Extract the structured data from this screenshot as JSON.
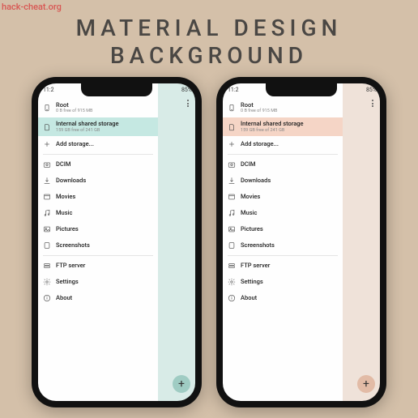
{
  "watermark": "hack-cheat.org",
  "heading_line1": "MATERIAL DESIGN",
  "heading_line2": "BACKGROUND",
  "phones": [
    {
      "accent": "teal",
      "status_time": "11:2",
      "status_right": "85%",
      "root": {
        "label": "Root",
        "sub": "0 B free of 915 MB"
      },
      "shared": {
        "label": "Internal shared storage",
        "sub": "159 GB free of 241 GB"
      },
      "add_storage": "Add storage...",
      "folders": [
        "DCIM",
        "Downloads",
        "Movies",
        "Music",
        "Pictures",
        "Screenshots"
      ],
      "ftp": "FTP server",
      "settings": "Settings",
      "about": "About",
      "fab": "+"
    },
    {
      "accent": "peach",
      "status_time": "11:2",
      "status_right": "85%",
      "root": {
        "label": "Root",
        "sub": "0 B free of 915 MB"
      },
      "shared": {
        "label": "Internal shared storage",
        "sub": "159 GB free of 241 GB"
      },
      "add_storage": "Add storage...",
      "folders": [
        "DCIM",
        "Downloads",
        "Movies",
        "Music",
        "Pictures",
        "Screenshots"
      ],
      "ftp": "FTP server",
      "settings": "Settings",
      "about": "About",
      "fab": "+"
    }
  ]
}
